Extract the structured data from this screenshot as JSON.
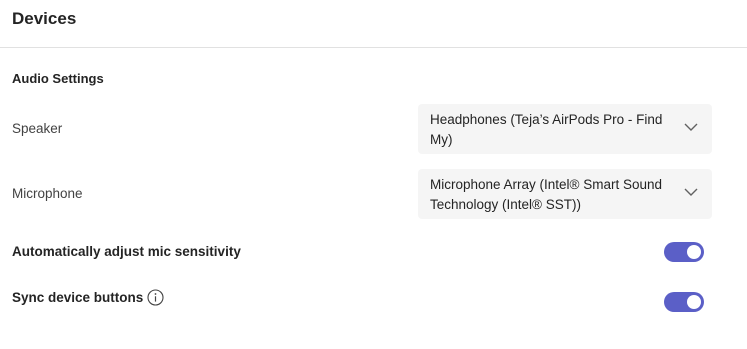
{
  "header": {
    "title": "Devices"
  },
  "audio_settings": {
    "section_title": "Audio Settings",
    "speaker": {
      "label": "Speaker",
      "selected_value": "Headphones (Teja’s AirPods Pro - Find My)",
      "icon": "chevron-down-icon"
    },
    "microphone": {
      "label": "Microphone",
      "selected_value": "Microphone Array (Intel® Smart Sound Technology (Intel® SST))",
      "icon": "chevron-down-icon"
    },
    "auto_adjust": {
      "label": "Automatically adjust mic sensitivity",
      "enabled": true
    },
    "sync_buttons": {
      "label": "Sync device buttons",
      "info_icon": "info-icon",
      "enabled": true
    }
  },
  "colors": {
    "toggle_on": "#5b5fc7",
    "dropdown_bg": "#f5f5f5",
    "divider": "#e1e1e1"
  }
}
